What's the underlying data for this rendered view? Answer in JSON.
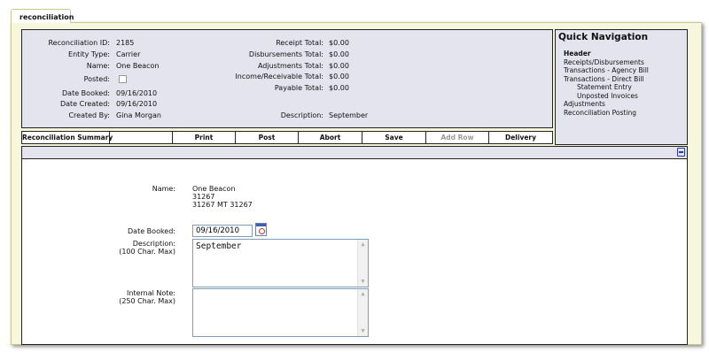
{
  "tab": {
    "label": "reconciliation"
  },
  "summary": {
    "left": [
      {
        "label": "Reconciliation ID:",
        "value": "2185"
      },
      {
        "label": "Entity Type:",
        "value": "Carrier"
      },
      {
        "label": "Name:",
        "value": "One Beacon"
      },
      {
        "label": "Posted:",
        "value": ""
      },
      {
        "label": "Date Booked:",
        "value": "09/16/2010"
      },
      {
        "label": "Date Created:",
        "value": "09/16/2010"
      },
      {
        "label": "Created By:",
        "value": "Gina Morgan"
      }
    ],
    "right": [
      {
        "label": "Receipt Total:",
        "value": "$0.00"
      },
      {
        "label": "Disbursements Total:",
        "value": "$0.00"
      },
      {
        "label": "Adjustments Total:",
        "value": "$0.00"
      },
      {
        "label": "Income/Receivable Total:",
        "value": "$0.00"
      },
      {
        "label": "Payable Total:",
        "value": "$0.00"
      },
      {
        "label": "Description:",
        "value": "September"
      }
    ]
  },
  "quick_nav": {
    "title": "Quick Navigation",
    "items": [
      "Header",
      "Receipts/Disbursements",
      "Transactions - Agency Bill",
      "Transactions - Direct Bill",
      "Statement Entry",
      "Unposted Invoices",
      "Adjustments",
      "Reconciliation Posting"
    ]
  },
  "toolbar": {
    "summary_label": "Reconciliation Summary",
    "print": "Print",
    "post": "Post",
    "abort": "Abort",
    "save": "Save",
    "add_row": "Add Row",
    "delivery": "Delivery"
  },
  "form": {
    "name_label": "Name:",
    "name_lines": [
      "One Beacon",
      "31267",
      "31267 MT 31267"
    ],
    "date_booked_label": "Date Booked:",
    "date_booked_value": "09/16/2010",
    "description_label": "Description:",
    "description_hint": "(100 Char. Max)",
    "description_value": "September",
    "note_label": "Internal Note:",
    "note_hint": "(250 Char. Max)",
    "note_value": ""
  },
  "icons": {
    "calendar": "calendar-icon",
    "minimize": "minimize-icon",
    "checkbox": "checkbox-icon"
  },
  "colors": {
    "panel_bg": "#e4e4ef",
    "frame_bg": "#f7f7dd",
    "border": "#222222"
  }
}
